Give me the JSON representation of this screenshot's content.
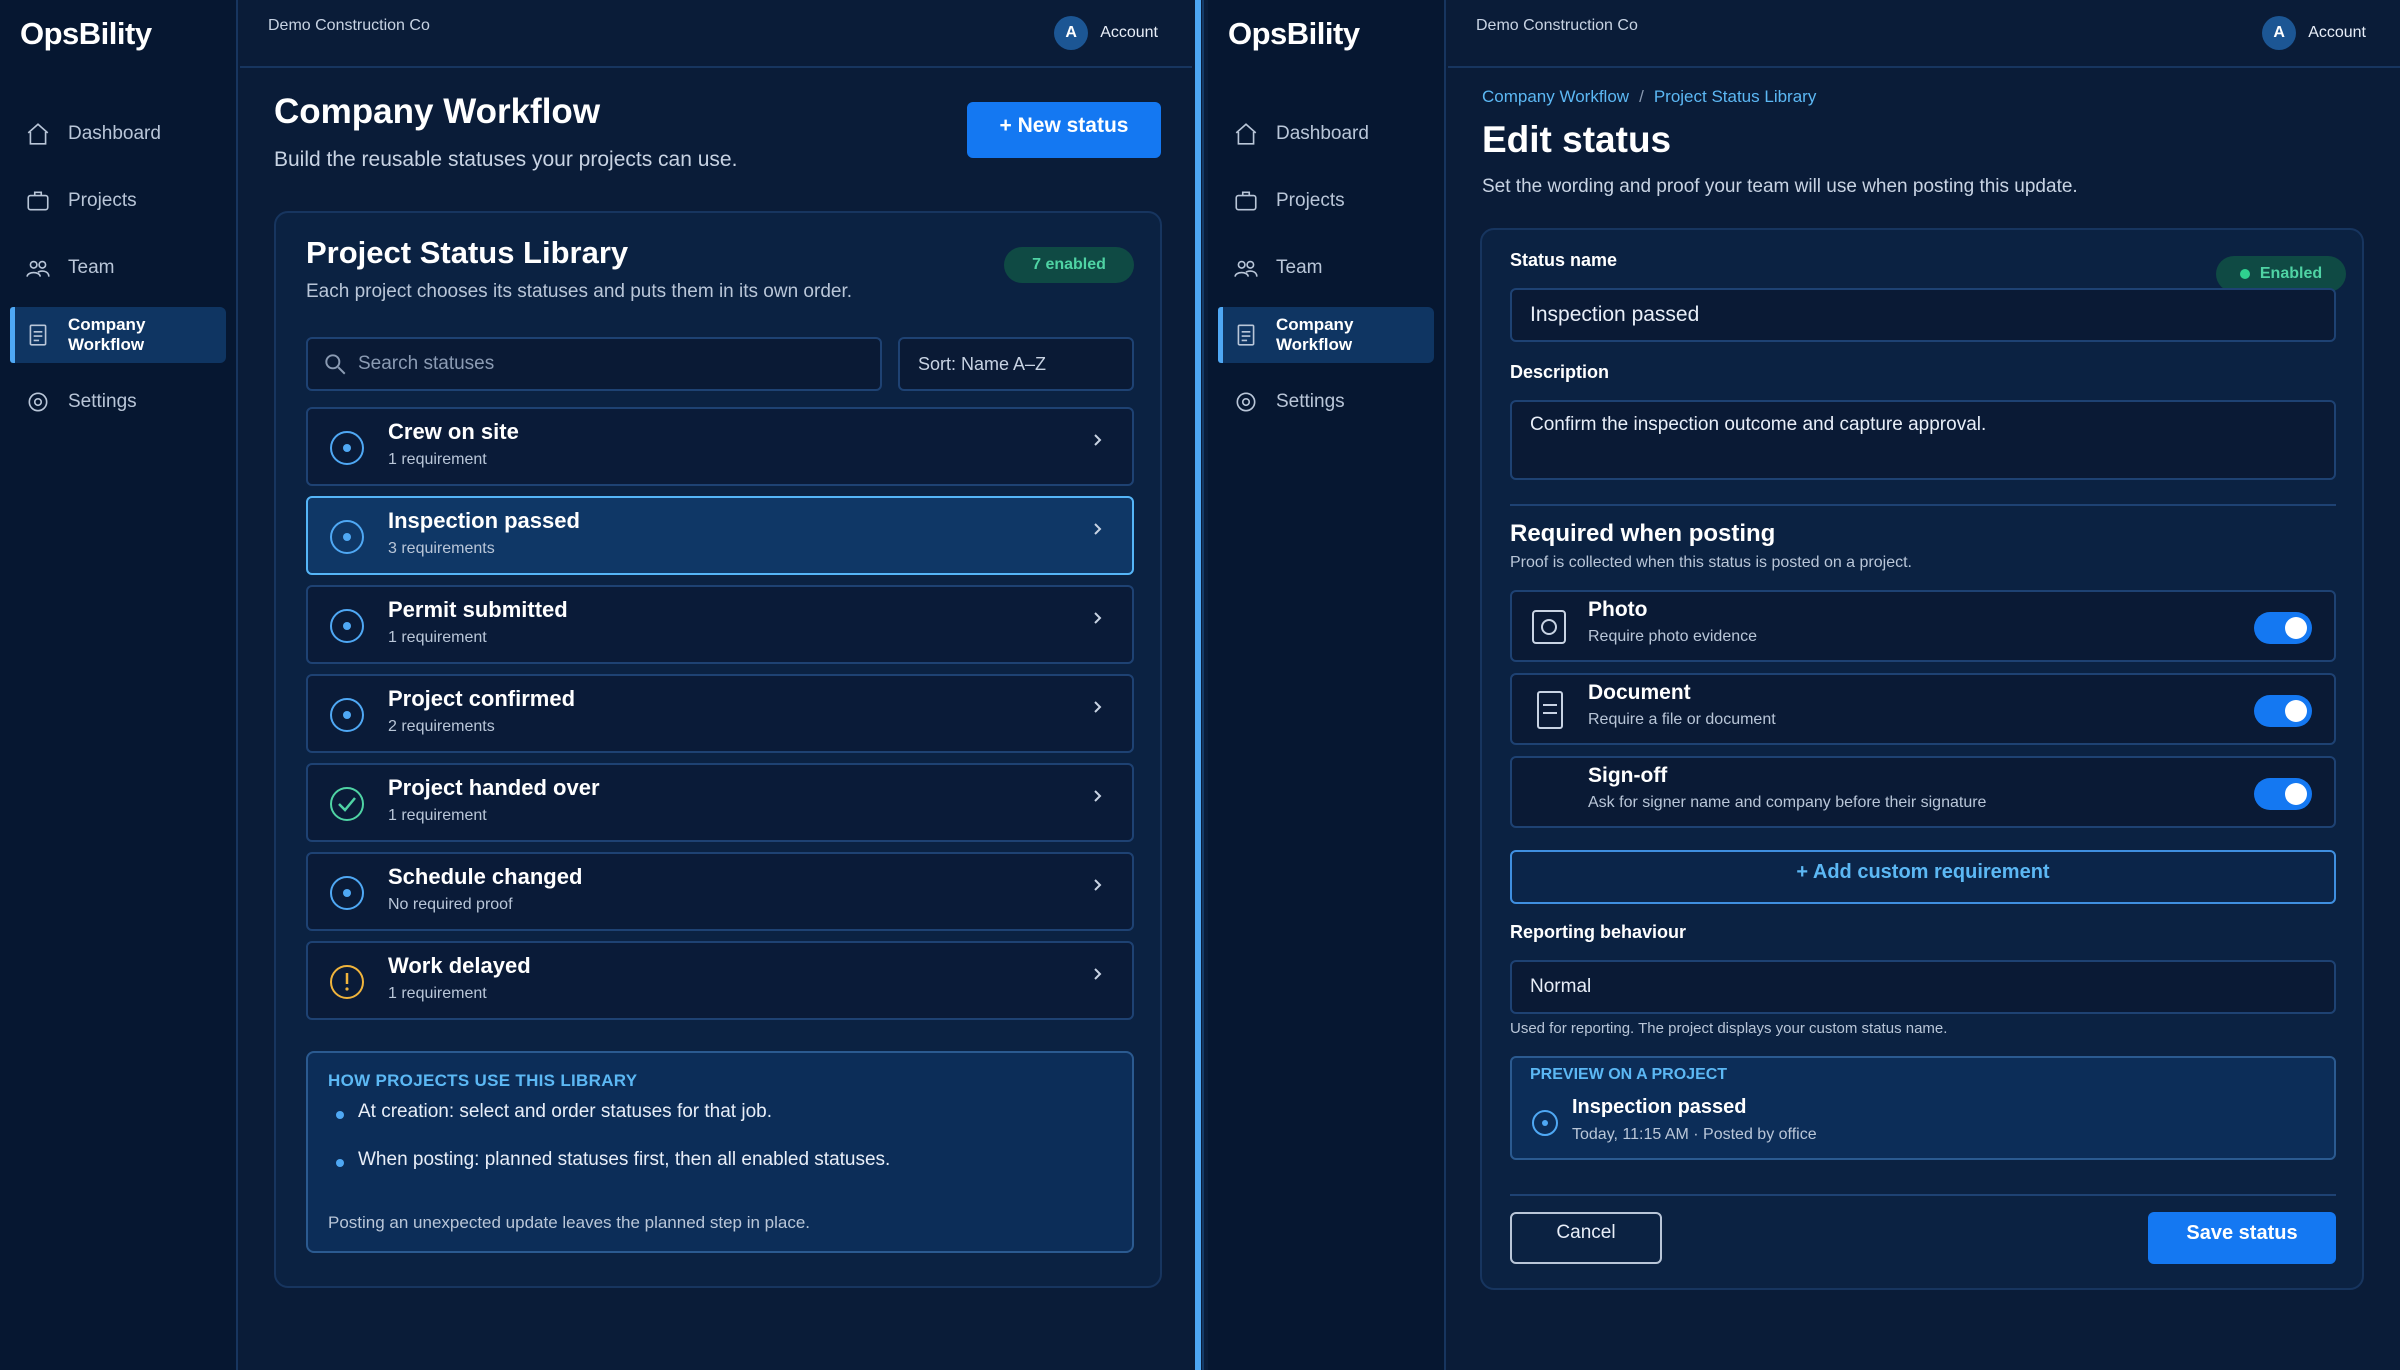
{
  "app": {
    "logo_text": "OpsBility"
  },
  "sidebar": {
    "items": [
      {
        "label": "Dashboard",
        "icon": "home-icon"
      },
      {
        "label": "Projects",
        "icon": "briefcase-icon"
      },
      {
        "label": "Team",
        "icon": "team-icon"
      },
      {
        "label": "Company Workflow",
        "icon": "document-icon",
        "active": true
      },
      {
        "label": "Settings",
        "icon": "settings-icon"
      }
    ]
  },
  "topbar": {
    "company": "Demo Construction Co",
    "avatar_initial": "A",
    "account_label": "Account"
  },
  "library_page": {
    "title": "Company Workflow",
    "subtitle": "Build the reusable statuses your projects can use.",
    "new_status_label": "+  New status",
    "card": {
      "title": "Project Status Library",
      "subtitle": "Each project chooses its statuses and puts them in its own order.",
      "enabled_badge": "7 enabled",
      "search_placeholder": "Search statuses",
      "sort_label": "Sort: Name A–Z",
      "statuses": [
        {
          "name": "Crew on site",
          "requirements": "1 requirement",
          "icon": "dot-circle-icon"
        },
        {
          "name": "Inspection passed",
          "requirements": "3 requirements",
          "icon": "dot-circle-icon",
          "selected": true
        },
        {
          "name": "Permit submitted",
          "requirements": "1 requirement",
          "icon": "dot-circle-icon"
        },
        {
          "name": "Project confirmed",
          "requirements": "2 requirements",
          "icon": "dot-circle-icon"
        },
        {
          "name": "Project handed over",
          "requirements": "1 requirement",
          "icon": "check-circle-icon"
        },
        {
          "name": "Schedule changed",
          "requirements": "No required proof",
          "icon": "dot-circle-icon"
        },
        {
          "name": "Work delayed",
          "requirements": "1 requirement",
          "icon": "warning-circle-icon"
        }
      ],
      "howto": {
        "title": "HOW PROJECTS USE THIS LIBRARY",
        "items": [
          "At creation: select and order statuses for that job.",
          "When posting: planned statuses first, then all enabled statuses."
        ],
        "footer": "Posting an unexpected update leaves the planned step in place."
      }
    }
  },
  "edit_page": {
    "breadcrumb": [
      "Company Workflow",
      "Project Status Library"
    ],
    "breadcrumb_separator": "/",
    "title": "Edit status",
    "subtitle": "Set the wording and proof your team will use when posting this update.",
    "status_name_label": "Status name",
    "enabled_label": "Enabled",
    "status_name_value": "Inspection passed",
    "description_label": "Description",
    "description_value": "Confirm the inspection outcome and capture approval.",
    "required_title": "Required when posting",
    "required_subtitle": "Proof is collected when this status is posted on a project.",
    "requirements": [
      {
        "name": "Photo",
        "description": "Require photo evidence",
        "icon": "camera-icon",
        "enabled": true
      },
      {
        "name": "Document",
        "description": "Require a file or document",
        "icon": "document-icon",
        "enabled": true
      },
      {
        "name": "Sign-off",
        "description": "Ask for signer name and company before their signature",
        "icon": "signature-icon",
        "enabled": true
      }
    ],
    "add_custom_label": "+  Add custom requirement",
    "reporting_label": "Reporting behaviour",
    "reporting_value": "Normal",
    "reporting_helper": "Used for reporting. The project displays your custom status name.",
    "preview": {
      "label": "PREVIEW ON A PROJECT",
      "name": "Inspection passed",
      "meta": "Today, 11:15 AM  ·  Posted by office"
    },
    "cancel_label": "Cancel",
    "save_label": "Save status"
  },
  "colors": {
    "background": "#081a33",
    "accent": "#1478f2",
    "link": "#5cb8f4",
    "success": "#4fd3a4",
    "warning": "#f0b43c"
  }
}
